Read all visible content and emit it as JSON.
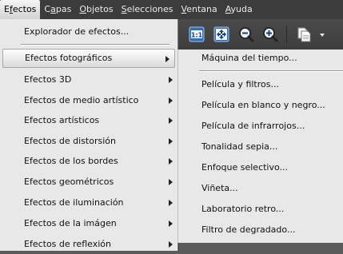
{
  "menubar": {
    "items": [
      {
        "pre": "E",
        "u": "f",
        "post": "ectos"
      },
      {
        "pre": "C",
        "u": "a",
        "post": "pas"
      },
      {
        "pre": "",
        "u": "O",
        "post": "bjetos"
      },
      {
        "pre": "",
        "u": "S",
        "post": "elecciones"
      },
      {
        "pre": "",
        "u": "V",
        "post": "entana"
      },
      {
        "pre": "",
        "u": "A",
        "post": "yuda"
      }
    ]
  },
  "toolbar": {
    "icons": [
      "actual-size-icon",
      "fit-window-icon",
      "zoom-out-icon",
      "zoom-in-icon",
      "document-icon",
      "dropdown-arrow-icon"
    ],
    "actual_size_text": "1:1"
  },
  "effects_menu": {
    "items": [
      {
        "label": "Explorador de efectos...",
        "submenu": false
      },
      {
        "label": "Efectos fotográficos",
        "submenu": true,
        "highlighted": true
      },
      {
        "label": "Efectos 3D",
        "submenu": true
      },
      {
        "label": "Efectos de medio artístico",
        "submenu": true
      },
      {
        "label": "Efectos artísticos",
        "submenu": true
      },
      {
        "label": "Efectos de distorsión",
        "submenu": true
      },
      {
        "label": "Efectos de los bordes",
        "submenu": true
      },
      {
        "label": "Efectos geométricos",
        "submenu": true
      },
      {
        "label": "Efectos de iluminación",
        "submenu": true
      },
      {
        "label": "Efectos de la imágen",
        "submenu": true
      },
      {
        "label": "Efectos de reflexión",
        "submenu": true
      }
    ]
  },
  "photo_submenu": {
    "items": [
      "Máquina del tiempo...",
      "Película y filtros...",
      "Película en blanco y negro...",
      "Película de infrarrojos...",
      "Tonalidad sepia...",
      "Enfoque selectivo...",
      "Viñeta...",
      "Laboratorio retro...",
      "Filtro de degradado..."
    ]
  }
}
